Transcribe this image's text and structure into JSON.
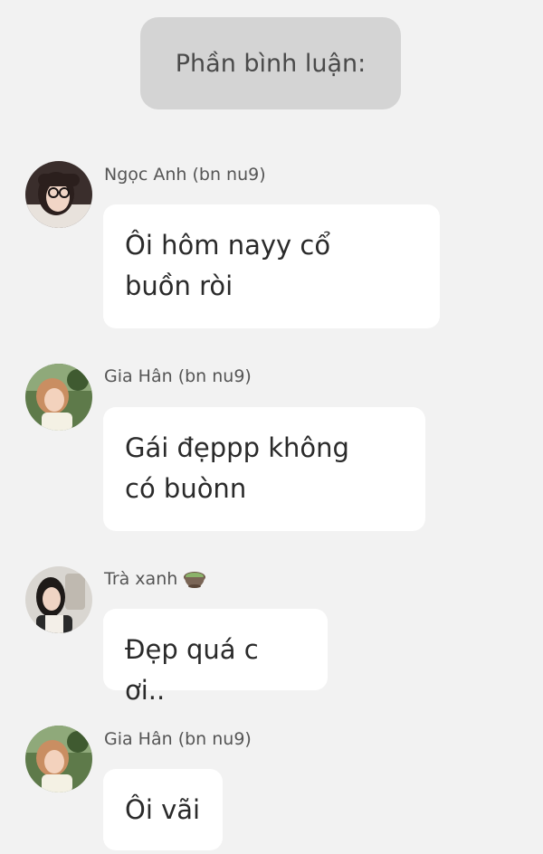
{
  "header": {
    "title": "Phần bình luận:"
  },
  "comments": [
    {
      "author": "Ngọc Anh (bn nu9)",
      "text_line1": "Ôi hôm nayy cổ",
      "text_line2": "buồn ròi",
      "avatar_icon": "avatar-photo-glasses"
    },
    {
      "author": "Gia Hân (bn nu9)",
      "text_line1": "Gái đẹppp không",
      "text_line2": "có buònn",
      "avatar_icon": "avatar-photo-outdoor"
    },
    {
      "author": "Trà xanh",
      "author_icon": "matcha-tea-icon",
      "text_line1": "Đẹp quá c ơi..",
      "avatar_icon": "avatar-photo-mirror-selfie"
    },
    {
      "author": "Gia Hân (bn nu9)",
      "text_line1": "Ôi vãi",
      "avatar_icon": "avatar-photo-outdoor"
    }
  ],
  "colors": {
    "background": "#f2f2f2",
    "header_pill": "#d4d4d4",
    "bubble": "#ffffff",
    "text": "#2a2a2a",
    "username": "#555555"
  }
}
